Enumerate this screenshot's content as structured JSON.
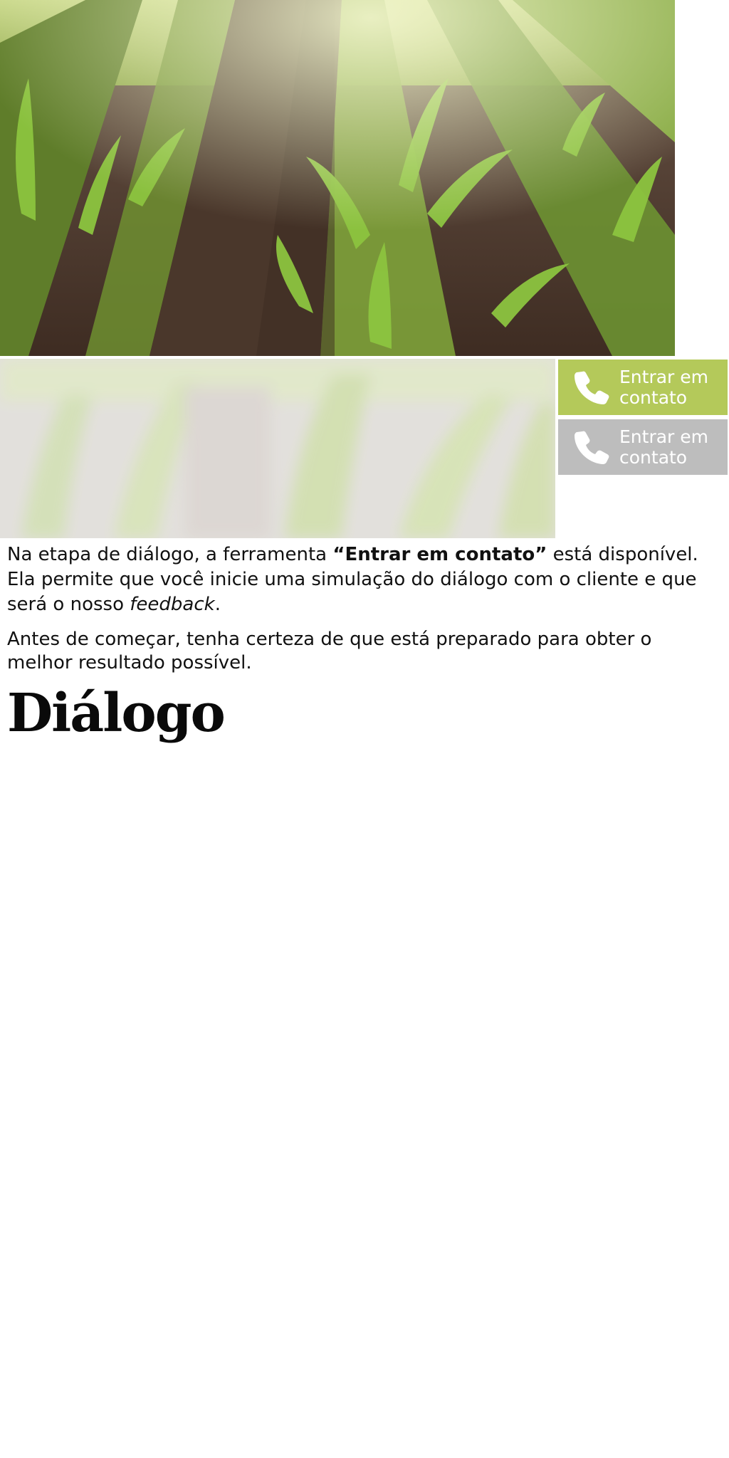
{
  "hero": {
    "image_name": "cornfield-photo"
  },
  "preview": {
    "image_name": "blurred-cornfield-preview"
  },
  "contact": {
    "buttons": [
      {
        "label": "Entrar em contato",
        "state": "active",
        "color": "#b4c95a",
        "icon": "phone-icon"
      },
      {
        "label": "Entrar em contato",
        "state": "inactive",
        "color": "#bdbdbd",
        "icon": "phone-icon"
      }
    ]
  },
  "intro": {
    "line1_before": "Na etapa de diálogo, a ferramenta ",
    "open_quote": "“",
    "tool_name": "Entrar em contato",
    "close_quote": "”",
    "line1_after": " está disponível.",
    "line2_before": "Ela permite que você inicie uma simulação do diálogo com o cliente e que será o nosso ",
    "line2_emph": "feedback",
    "line2_after": "."
  },
  "advice": {
    "text": "Antes de começar, tenha certeza de que está preparado para obter o melhor resultado possível."
  },
  "heading": {
    "title": "Diálogo"
  },
  "colors": {
    "accent": "#b4c95a",
    "disabled": "#bdbdbd",
    "text": "#111111"
  }
}
